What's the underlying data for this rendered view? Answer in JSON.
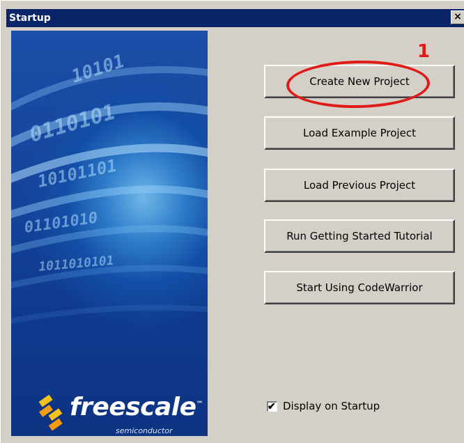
{
  "window": {
    "title": "Startup",
    "close_label": "✕"
  },
  "banner": {
    "logo_text": "freescale",
    "logo_trademark": "™",
    "logo_subtitle": "semiconductor"
  },
  "buttons": {
    "create_new_project": "Create New Project",
    "load_example_project": "Load Example Project",
    "load_previous_project": "Load Previous Project",
    "run_tutorial": "Run Getting Started Tutorial",
    "start_codewarrior": "Start Using CodeWarrior"
  },
  "annotation": {
    "number": "1",
    "color": "#e01919"
  },
  "options": {
    "display_on_startup_label": "Display on Startup",
    "display_on_startup_checked": true,
    "check_glyph": "✔"
  },
  "colors": {
    "titlebar": "#0a246a",
    "dialog_face": "#d4d0c8",
    "banner_blue": "#134ea6"
  }
}
